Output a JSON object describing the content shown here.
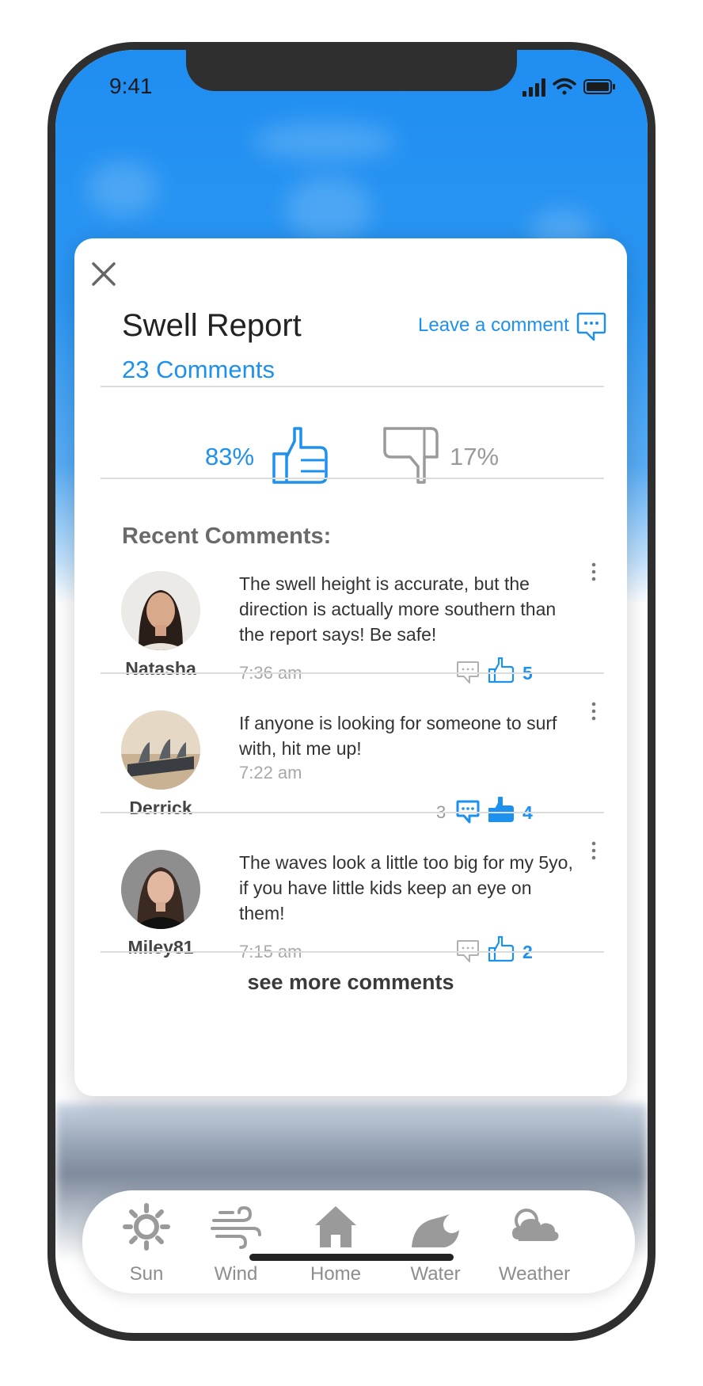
{
  "status_bar": {
    "time": "9:41"
  },
  "report": {
    "title": "Swell Report",
    "comments_count": "23 Comments",
    "leave_comment": "Leave a comment",
    "thumbs_up_pct": "83%",
    "thumbs_down_pct": "17%",
    "recent_label": "Recent Comments:"
  },
  "comments": [
    {
      "user": "Natasha",
      "text": "The swell height is accurate, but the direction is actually more southern than the report says! Be safe!",
      "time": "7:36 am",
      "replies": "",
      "likes": "5"
    },
    {
      "user": "Derrick",
      "text": "If anyone is looking for someone to surf with, hit me up!",
      "time": "7:22 am",
      "replies": "3",
      "likes": "4"
    },
    {
      "user": "Miley81",
      "text": "The waves look a little too big for my 5yo, if you have little kids keep an eye on them!",
      "time": "7:15 am",
      "replies": "",
      "likes": "2"
    }
  ],
  "see_more": "see more comments",
  "tabs": [
    {
      "label": "Sun",
      "icon": "sun-icon"
    },
    {
      "label": "Wind",
      "icon": "wind-icon"
    },
    {
      "label": "Home",
      "icon": "home-icon"
    },
    {
      "label": "Water",
      "icon": "water-icon"
    },
    {
      "label": "Weather",
      "icon": "weather-icon"
    }
  ],
  "colors": {
    "accent": "#1e90ee",
    "muted": "#9a9a9a",
    "sky": "#2b96f3"
  }
}
